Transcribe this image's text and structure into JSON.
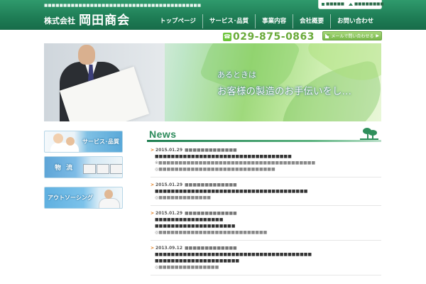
{
  "header": {
    "tagline": "■■■■■■■■■■■■■■■■■■■■■■■■■■■■■■■■■■■■■■■■■",
    "company_prefix": "株式会社",
    "company_name": "岡田商会",
    "top_links": [
      {
        "label": "■■■■■",
        "icon": "square-icon"
      },
      {
        "label": "■■■■■■■■",
        "icon": "triangle-icon"
      }
    ],
    "nav": [
      "トップページ",
      "サービス･品質",
      "事業内容",
      "会社概要",
      "お問い合わせ"
    ],
    "phone": "029-875-0863",
    "mail_button": "メールで問い合わせる"
  },
  "hero": {
    "line1": "あるときは",
    "line2": "お客様の製造のお手伝いをし…"
  },
  "sidebar": {
    "banners": [
      "サービス･品質",
      "物 流",
      "アウトソーシング"
    ]
  },
  "news": {
    "title": "News",
    "items": [
      {
        "date": "2015.01.29",
        "category": "■■■■■■■■■■■■■",
        "lines": [
          "■■■■■■■■■■■■■■■■■■■■■■■■■■■■■■■■■■",
          "※■■■■■■■■■■■■■■■■■■■■■■■■■■■■■■■■■■■■■■■",
          "◎■■■■■■■■■■■■■■■■■■■■■■■■■■■■■"
        ]
      },
      {
        "date": "2015.01.29",
        "category": "■■■■■■■■■■■■■",
        "lines": [
          "■■■■■■■■■■■■■■■■■■■■■■■■■■■■■■■■■■■■■■",
          "◎■■■■■■■■■■■■■"
        ]
      },
      {
        "date": "2015.01.29",
        "category": "■■■■■■■■■■■■■",
        "lines": [
          "■■■■■■■■■■■■■■■■■",
          "■■■■■■■■■■■■■■■■■■■■",
          "◎■■■■■■■■■■■■■■■■■■■■■■■■■■■"
        ]
      },
      {
        "date": "2013.09.12",
        "category": "■■■■■■■■■■■■■",
        "lines": [
          "■■■■■■■■■■■■■■■■■■■■■■■■■■■■■■■■■■■■■■■",
          "■■■■■■■■■■■■■■■■■■■■■",
          "◎■■■■■■■■■■■■■■■"
        ]
      }
    ]
  },
  "colors": {
    "brand_green": "#1e7c55",
    "accent_lime": "#7ab84c",
    "phone_green": "#6aaa3a",
    "news_arrow": "#e07b1a"
  }
}
